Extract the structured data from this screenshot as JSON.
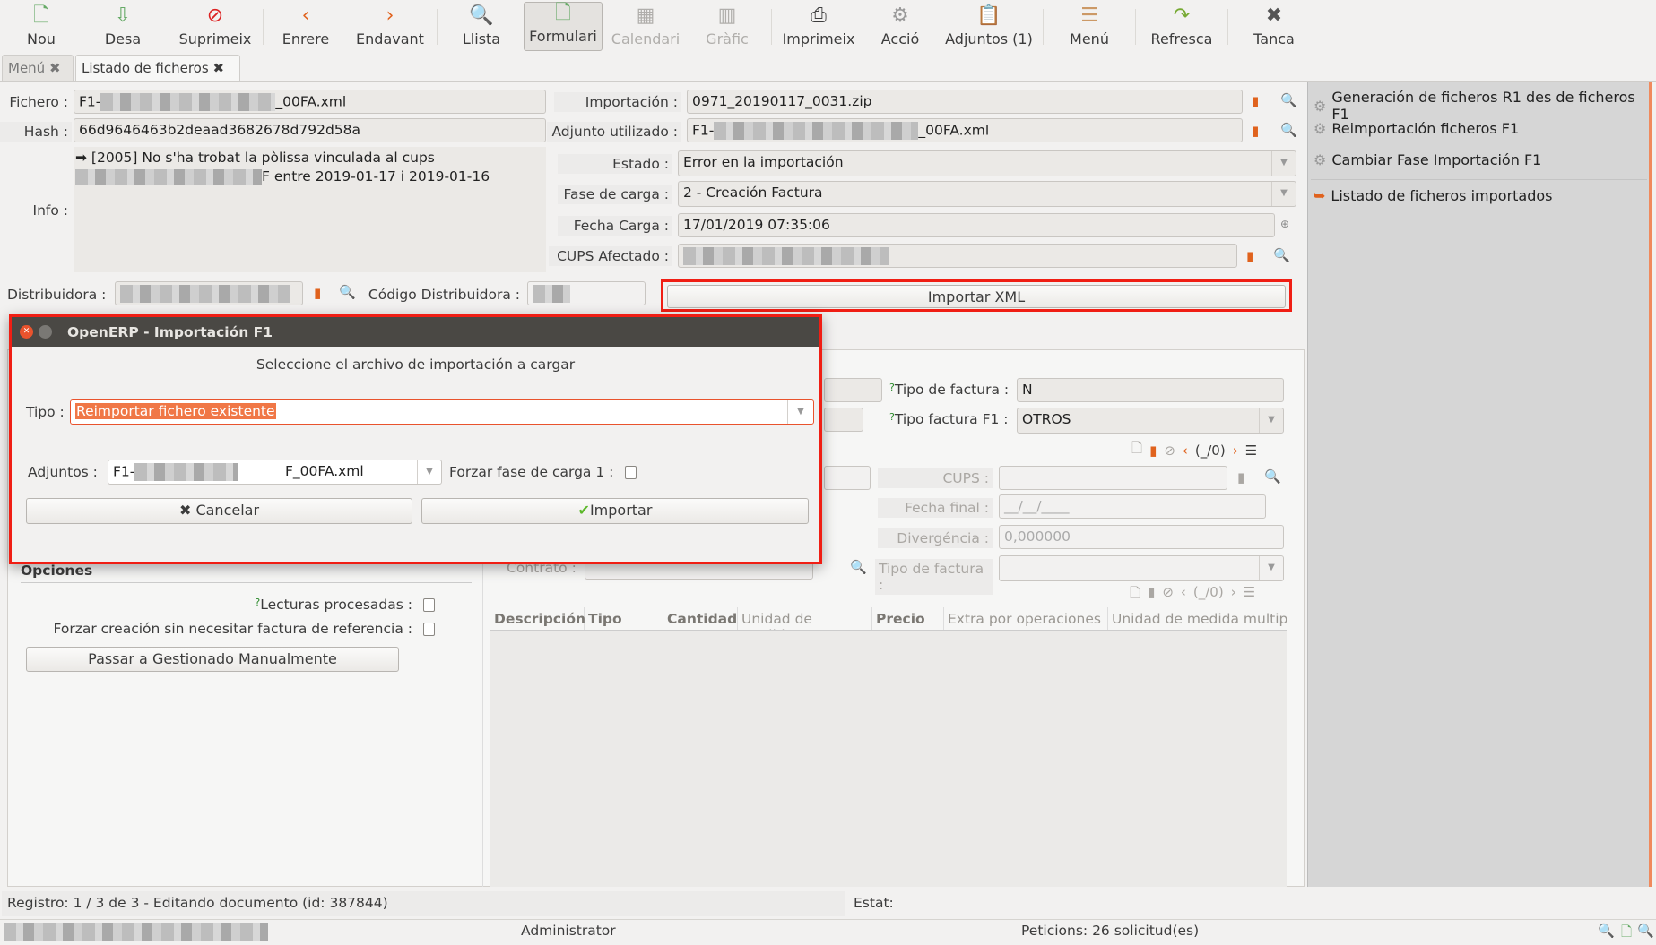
{
  "toolbar": [
    {
      "label": "Nou",
      "icon": "new-document-icon"
    },
    {
      "label": "Desa",
      "icon": "save-icon"
    },
    {
      "label": "Suprimeix",
      "icon": "delete-icon"
    },
    {
      "label": "Enrere",
      "icon": "back-icon"
    },
    {
      "label": "Endavant",
      "icon": "forward-icon"
    },
    {
      "label": "Llista",
      "icon": "list-search-icon"
    },
    {
      "label": "Formulari",
      "icon": "form-icon"
    },
    {
      "label": "Calendari",
      "icon": "calendar-icon"
    },
    {
      "label": "Gràfic",
      "icon": "graph-icon"
    },
    {
      "label": "Imprimeix",
      "icon": "print-icon"
    },
    {
      "label": "Acció",
      "icon": "action-gears-icon"
    },
    {
      "label": "Adjuntos (1)",
      "icon": "attachment-icon"
    },
    {
      "label": "Menú",
      "icon": "menu-icon"
    },
    {
      "label": "Refresca",
      "icon": "refresh-icon"
    },
    {
      "label": "Tanca",
      "icon": "close-icon"
    }
  ],
  "tabs": [
    {
      "label": "Menú"
    },
    {
      "label": "Listado de ficheros"
    }
  ],
  "form": {
    "fichero_label": "Fichero :",
    "fichero_prefix": "F1-",
    "fichero_suffix": "_00FA.xml",
    "hash_label": "Hash :",
    "hash": "66d9646463b2deaad3682678d792d58a",
    "info_label": "Info :",
    "info_line1": "➡ [2005] No s'ha trobat la pòlissa vinculada al cups",
    "info_line2": "F entre 2019-01-17 i 2019-01-16",
    "importacion_label": "Importación :",
    "importacion": "0971_20190117_0031.zip",
    "adjunto_label": "Adjunto utilizado :",
    "adjunto_prefix": "F1-",
    "adjunto_suffix": "_00FA.xml",
    "estado_label": "Estado :",
    "estado": "Error en la importación",
    "fase_label": "Fase de carga :",
    "fase": "2 - Creación Factura",
    "fecha_label": "Fecha Carga :",
    "fecha": "17/01/2019 07:35:06",
    "cups_label": "CUPS Afectado :",
    "distribuidora_label": "Distribuidora :",
    "codigo_label": "Código Distribuidora :",
    "importar_xml": "Importar XML"
  },
  "sidebar": [
    {
      "label": "Generación de ficheros R1 des de ficheros F1"
    },
    {
      "label": "Reimportación ficheros F1"
    },
    {
      "label": "Cambiar Fase Importación F1"
    },
    {
      "label": "Listado de ficheros importados"
    }
  ],
  "lower": {
    "opciones": "Opciones",
    "lecturas": "Lecturas procesadas :",
    "forzar": "Forzar creación sin necesitar factura de referencia :",
    "passar": "Passar a Gestionado Manualmente",
    "tipo_factura_label": "Tipo de factura :",
    "tipo_factura": "N",
    "tipo_f1_label": "Tipo factura F1 :",
    "tipo_f1": "OTROS",
    "pager": "(_/0)",
    "cups_label": "CUPS :",
    "fecha_final_label": "Fecha final :",
    "fecha_final": "__/__/____",
    "divergencia_label": "Divergéncia :",
    "divergencia": "0,000000",
    "contrato_label": "Contrato :",
    "tipo_factura2_label": "Tipo de factura :",
    "columns": [
      "Descripción",
      "Tipo",
      "Cantidad",
      "Unidad de medida",
      "Precio",
      "Extra por operaciones",
      "Unidad de medida multip"
    ]
  },
  "dialog": {
    "title": "OpenERP - Importación F1",
    "subtitle": "Seleccione el archivo de importación a cargar",
    "tipo_label": "Tipo :",
    "tipo": "Reimportar fichero existente",
    "adjuntos_label": "Adjuntos :",
    "adjuntos_prefix": "F1-",
    "adjuntos_suffix": "F_00FA.xml",
    "forzar_label": "Forzar fase de carga 1 :",
    "cancel": "Cancelar",
    "import": "Importar"
  },
  "status": {
    "registro": "Registro: 1 / 3 de 3 - Editando documento (id: 387844)",
    "estat": "Estat:",
    "user": "Administrator",
    "peticions": "Peticions:  26 solicitud(es)"
  },
  "colors": {
    "highlight": "#f26522",
    "accent": "#e0621d",
    "dialog_title": "#4a4844"
  }
}
